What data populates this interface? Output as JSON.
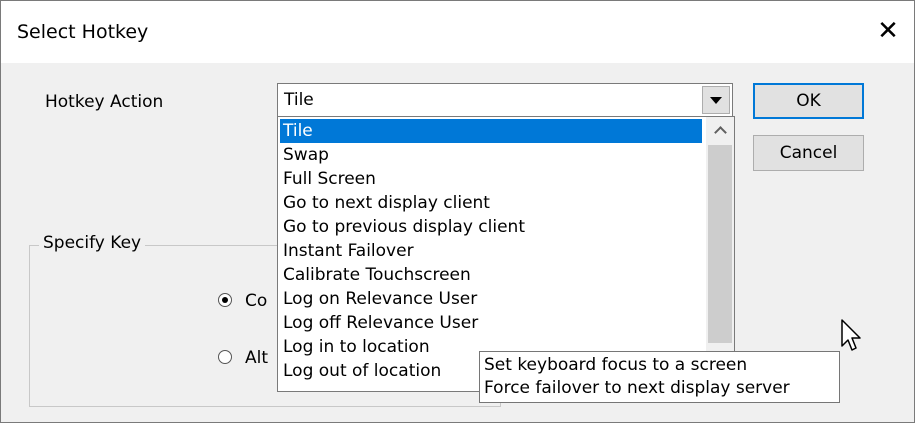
{
  "dialog": {
    "title": "Select Hotkey",
    "close_glyph": "✕"
  },
  "hotkey_action": {
    "label": "Hotkey Action",
    "selected_value": "Tile",
    "options": [
      "Tile",
      "Swap",
      "Full Screen",
      "Go to next display client",
      "Go to previous display client",
      "Instant Failover",
      "Calibrate Touchscreen",
      "Log on Relevance User",
      "Log off Relevance User",
      "Log in to location",
      "Log out of location"
    ],
    "highlighted_index": 0
  },
  "buttons": {
    "ok_label": "OK",
    "cancel_label": "Cancel"
  },
  "specify_key": {
    "group_title": "Specify Key",
    "radio_1_partial_label": "Co",
    "radio_1_checked": true,
    "radio_2_partial_label": "Alt",
    "radio_2_checked": false,
    "partial_text": "t"
  },
  "tooltip": {
    "lines": [
      "Set keyboard focus to a screen",
      "Force failover to next display server"
    ]
  },
  "colors": {
    "selection": "#0078d7",
    "dialog_bg": "#f0f0f0",
    "button_bg": "#e1e1e1"
  },
  "icons": {
    "close": "close-icon",
    "dropdown": "chevron-down-icon",
    "scroll_up": "chevron-up-icon",
    "cursor": "mouse-pointer-icon"
  }
}
